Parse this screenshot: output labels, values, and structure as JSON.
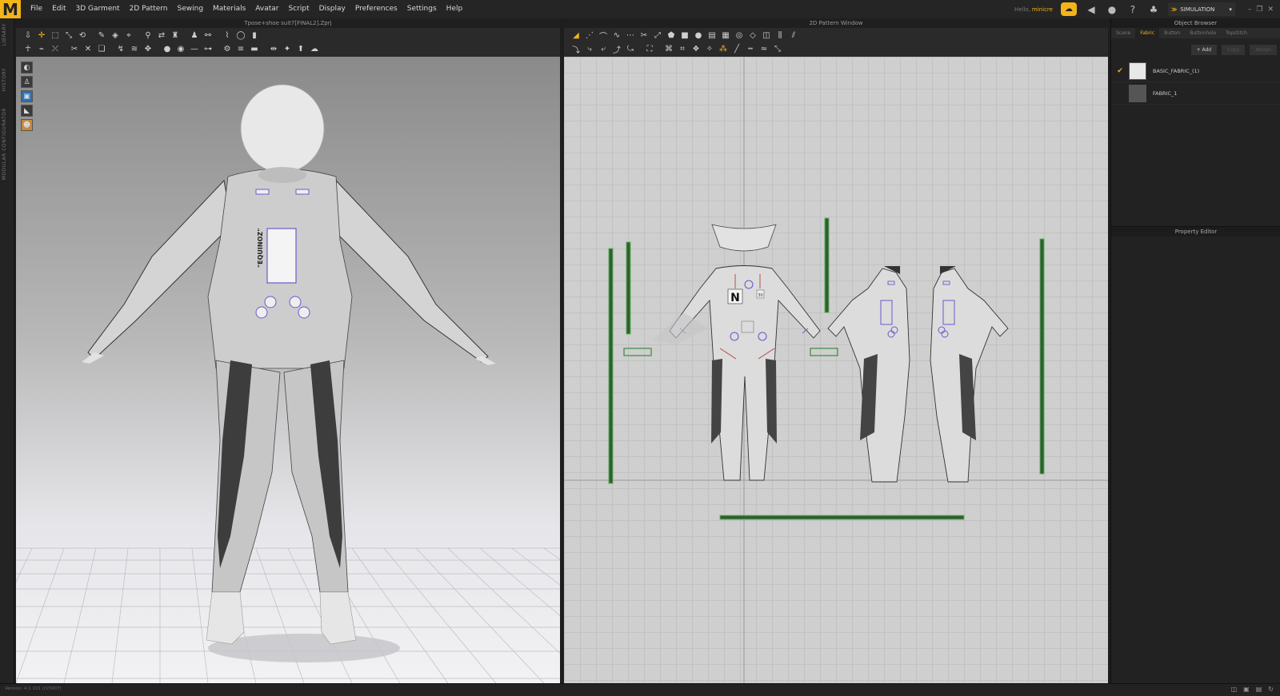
{
  "app": {
    "logo_letter": "M",
    "menu": [
      "File",
      "Edit",
      "3D Garment",
      "2D Pattern",
      "Sewing",
      "Materials",
      "Avatar",
      "Script",
      "Display",
      "Preferences",
      "Settings",
      "Help"
    ],
    "user_greeting": "Hello,",
    "user_name": "minicre",
    "mode": "SIMULATION"
  },
  "panels": {
    "view3d_title": "Tpose+shoe suit7[FINAL2].Zprj",
    "view2d_title": "2D Pattern Window",
    "object_browser_title": "Object Browser",
    "property_editor_title": "Property Editor"
  },
  "left_strip": [
    "LIBRARY",
    "HISTORY",
    "MODULAR CONFIGURATOR"
  ],
  "object_browser": {
    "tabs": [
      "Scene",
      "Fabric",
      "Button",
      "Buttonhole",
      "Topstitch"
    ],
    "active_tab": "Fabric",
    "actions": [
      "+ Add",
      "Copy",
      "Assign"
    ],
    "fabrics": [
      {
        "name": "BASIC_FABRIC_(1)",
        "checked": true,
        "swatch": "#e8e8e8"
      },
      {
        "name": "FABRIC_1",
        "checked": false,
        "swatch": "#555555"
      }
    ]
  },
  "garment": {
    "print_text": "\"EQUINOZ\"",
    "front_letter": "N",
    "badge_number": "30"
  },
  "status": {
    "version": "Version: 4.1.101 (r15907)"
  },
  "colors": {
    "accent": "#f2b418",
    "pattern_outline_selected": "#3b8a3b"
  }
}
